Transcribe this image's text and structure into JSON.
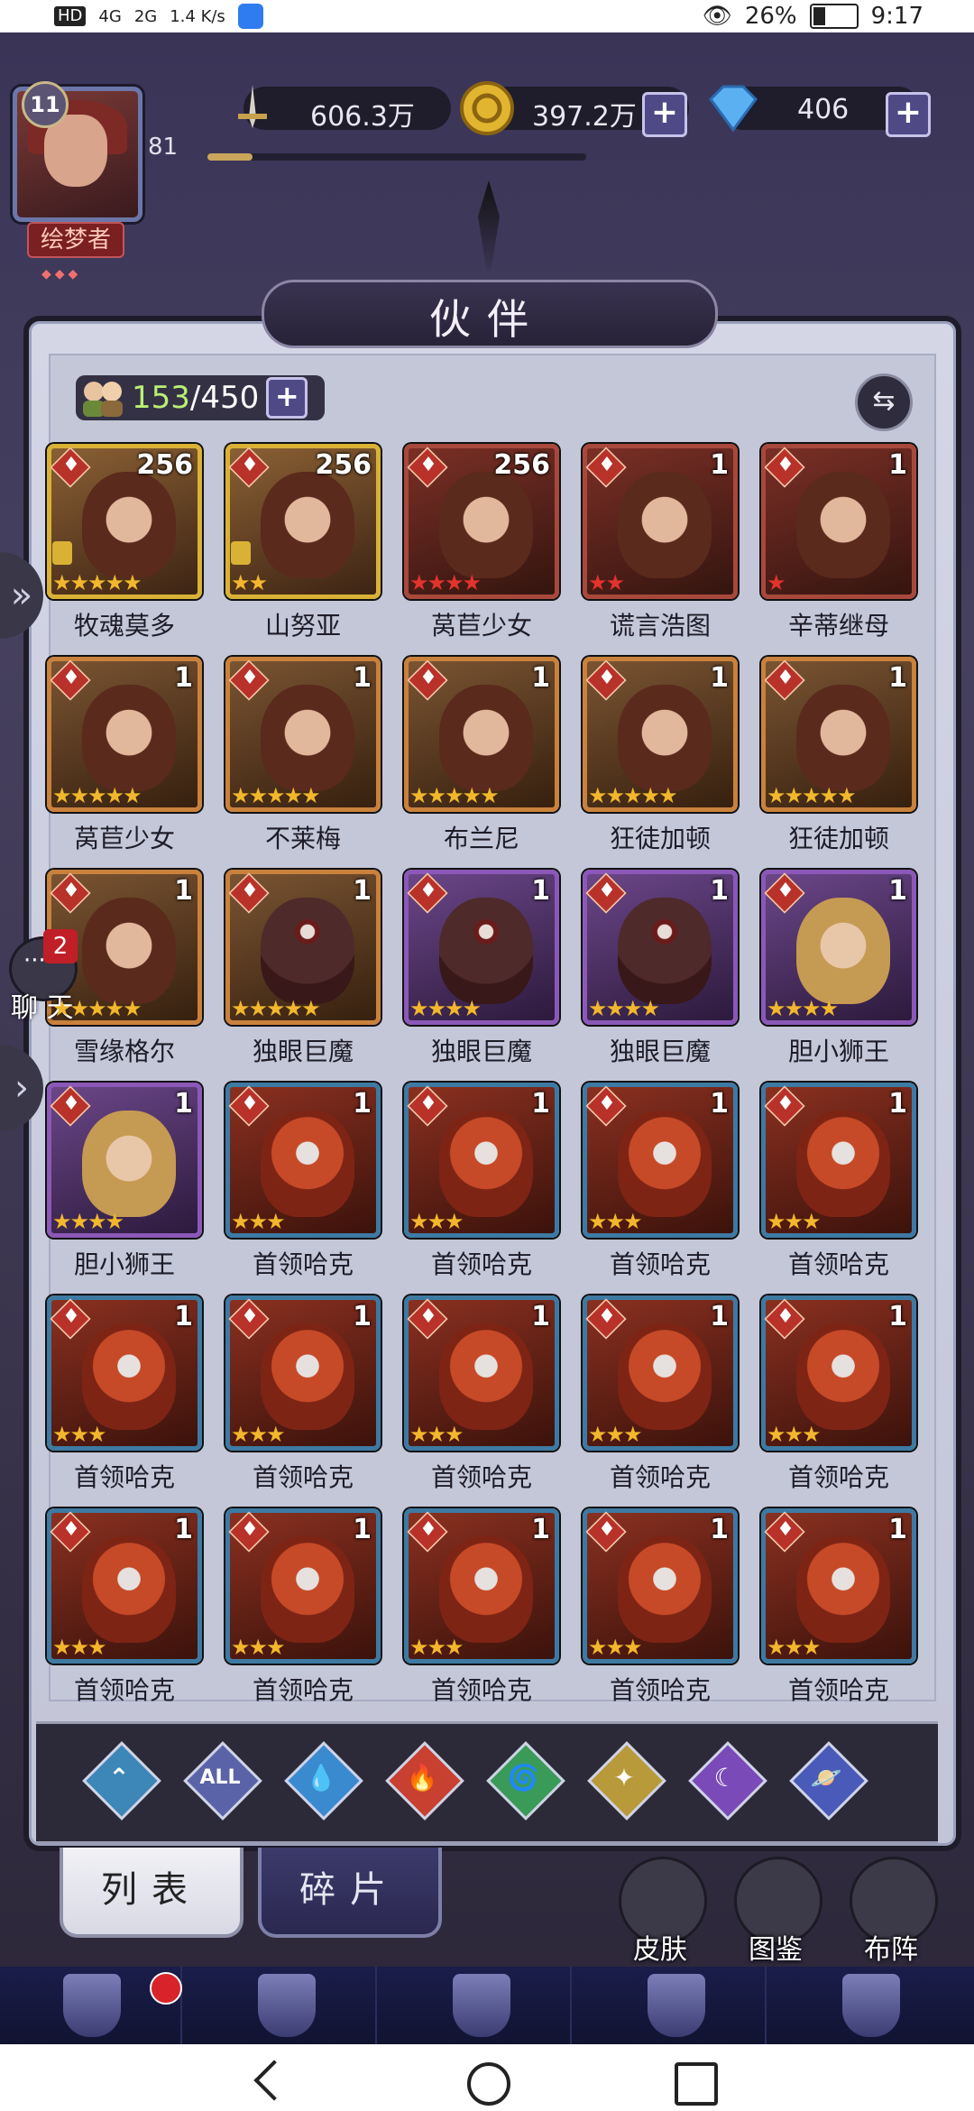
{
  "statusbar": {
    "left": [
      "HD",
      "4G",
      "2G",
      "1.4 K/s"
    ],
    "eye": "👁",
    "battery": "26%",
    "time": "9:17"
  },
  "player": {
    "level": "11",
    "exp": "81",
    "exp_fraction": 0.12,
    "title": "绘梦者",
    "title_gems": "◆◆◆"
  },
  "resources": [
    {
      "icon": "sword-icon",
      "value": "606.3万"
    },
    {
      "icon": "gold-coin-icon",
      "value": "397.2万",
      "plus": "+"
    },
    {
      "icon": "diamond-icon",
      "value": "406",
      "plus": "+"
    }
  ],
  "page_title": "伙伴",
  "roster": {
    "count": "153",
    "max": "/450",
    "plus": "+",
    "swap": "⇆"
  },
  "chat": {
    "badge": "2",
    "label": "聊 天"
  },
  "cards": [
    {
      "name": "牧魂莫多",
      "level": "256",
      "stars": "★★★★★",
      "star_color": "gold",
      "frame": "gold",
      "locked": true
    },
    {
      "name": "山努亚",
      "level": "256",
      "stars": "★★",
      "star_color": "gold",
      "frame": "gold",
      "locked": true
    },
    {
      "name": "莴苣少女",
      "level": "256",
      "stars": "★★★★",
      "star_color": "redc",
      "frame": "red",
      "locked": false
    },
    {
      "name": "谎言浩图",
      "level": "1",
      "stars": "★★",
      "star_color": "redc",
      "frame": "red",
      "locked": false
    },
    {
      "name": "辛蒂继母",
      "level": "1",
      "stars": "★",
      "star_color": "redc",
      "frame": "red",
      "locked": false
    },
    {
      "name": "莴苣少女",
      "level": "1",
      "stars": "★★★★★",
      "star_color": "gold",
      "frame": "orange",
      "locked": false
    },
    {
      "name": "不莱梅",
      "level": "1",
      "stars": "★★★★★",
      "star_color": "gold",
      "frame": "orange",
      "locked": false
    },
    {
      "name": "布兰尼",
      "level": "1",
      "stars": "★★★★★",
      "star_color": "gold",
      "frame": "orange",
      "locked": false
    },
    {
      "name": "狂徒加顿",
      "level": "1",
      "stars": "★★★★★",
      "star_color": "gold",
      "frame": "orange",
      "locked": false
    },
    {
      "name": "狂徒加顿",
      "level": "1",
      "stars": "★★★★★",
      "star_color": "gold",
      "frame": "orange",
      "locked": false
    },
    {
      "name": "雪缘格尔",
      "level": "1",
      "stars": "★★★★★",
      "star_color": "gold",
      "frame": "orange",
      "locked": false
    },
    {
      "name": "独眼巨魔",
      "level": "1",
      "stars": "★★★★★",
      "star_color": "gold",
      "frame": "orange",
      "locked": false,
      "cyclops": true
    },
    {
      "name": "独眼巨魔",
      "level": "1",
      "stars": "★★★★",
      "star_color": "gold",
      "frame": "purple",
      "locked": false,
      "cyclops": true
    },
    {
      "name": "独眼巨魔",
      "level": "1",
      "stars": "★★★★",
      "star_color": "gold",
      "frame": "purple",
      "locked": false,
      "cyclops": true
    },
    {
      "name": "胆小狮王",
      "level": "1",
      "stars": "★★★★",
      "star_color": "gold",
      "frame": "purple",
      "locked": false
    },
    {
      "name": "胆小狮王",
      "level": "1",
      "stars": "★★★★",
      "star_color": "gold",
      "frame": "purple",
      "locked": false
    },
    {
      "name": "首领哈克",
      "level": "1",
      "stars": "★★★",
      "star_color": "gold",
      "frame": "blue",
      "locked": false
    },
    {
      "name": "首领哈克",
      "level": "1",
      "stars": "★★★",
      "star_color": "gold",
      "frame": "blue",
      "locked": false
    },
    {
      "name": "首领哈克",
      "level": "1",
      "stars": "★★★",
      "star_color": "gold",
      "frame": "blue",
      "locked": false
    },
    {
      "name": "首领哈克",
      "level": "1",
      "stars": "★★★",
      "star_color": "gold",
      "frame": "blue",
      "locked": false
    },
    {
      "name": "首领哈克",
      "level": "1",
      "stars": "★★★",
      "star_color": "gold",
      "frame": "blue",
      "locked": false
    },
    {
      "name": "首领哈克",
      "level": "1",
      "stars": "★★★",
      "star_color": "gold",
      "frame": "blue",
      "locked": false
    },
    {
      "name": "首领哈克",
      "level": "1",
      "stars": "★★★",
      "star_color": "gold",
      "frame": "blue",
      "locked": false
    },
    {
      "name": "首领哈克",
      "level": "1",
      "stars": "★★★",
      "star_color": "gold",
      "frame": "blue",
      "locked": false
    },
    {
      "name": "首领哈克",
      "level": "1",
      "stars": "★★★",
      "star_color": "gold",
      "frame": "blue",
      "locked": false
    },
    {
      "name": "首领哈克",
      "level": "1",
      "stars": "★★★",
      "star_color": "gold",
      "frame": "blue",
      "locked": false
    },
    {
      "name": "首领哈克",
      "level": "1",
      "stars": "★★★",
      "star_color": "gold",
      "frame": "blue",
      "locked": false
    },
    {
      "name": "首领哈克",
      "level": "1",
      "stars": "★★★",
      "star_color": "gold",
      "frame": "blue",
      "locked": false
    },
    {
      "name": "首领哈克",
      "level": "1",
      "stars": "★★★",
      "star_color": "gold",
      "frame": "blue",
      "locked": false
    },
    {
      "name": "首领哈克",
      "level": "1",
      "stars": "★★★",
      "star_color": "gold",
      "frame": "blue",
      "locked": false
    }
  ],
  "filters": [
    {
      "name": "filter-favorite-icon",
      "glyph": "⌃",
      "color": "#3d86b8"
    },
    {
      "name": "filter-all-icon",
      "glyph": "ALL",
      "color": "#5b63a8"
    },
    {
      "name": "filter-water-icon",
      "glyph": "💧",
      "color": "#3a8ad0"
    },
    {
      "name": "filter-fire-icon",
      "glyph": "🔥",
      "color": "#c84030"
    },
    {
      "name": "filter-wind-icon",
      "glyph": "🌀",
      "color": "#3a9a58"
    },
    {
      "name": "filter-light-icon",
      "glyph": "✦",
      "color": "#b89a3a"
    },
    {
      "name": "filter-dark-icon",
      "glyph": "☾",
      "color": "#7a4ab8"
    },
    {
      "name": "filter-cosmic-icon",
      "glyph": "🪐",
      "color": "#4a5ab8"
    }
  ],
  "tabs": {
    "list": "列表",
    "fragments": "碎片"
  },
  "side_buttons": [
    {
      "label": "皮肤",
      "icon": "skin-icon"
    },
    {
      "label": "图鉴",
      "icon": "codex-icon"
    },
    {
      "label": "布阵",
      "icon": "formation-icon"
    }
  ],
  "bottom_nav": [
    "castle-icon",
    "wizard-hat-icon",
    "compass-icon",
    "shield-icon",
    "cards-icon"
  ]
}
